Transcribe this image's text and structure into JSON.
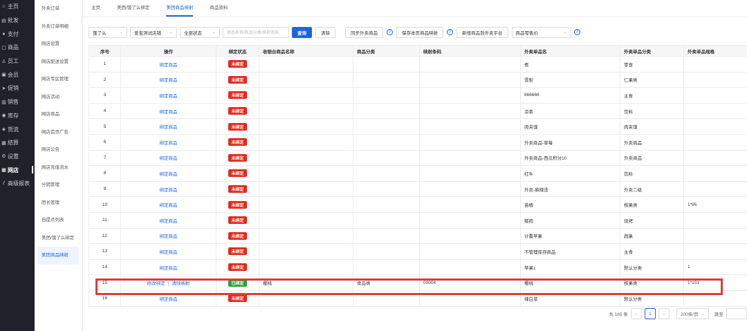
{
  "sidebar": {
    "items": [
      {
        "label": "主页",
        "icon": "home-icon",
        "glyph": "⌂",
        "active": false
      },
      {
        "label": "批发",
        "icon": "list-icon",
        "glyph": "▤",
        "active": false
      },
      {
        "label": "支付",
        "icon": "pay-icon",
        "glyph": "●",
        "active": false
      },
      {
        "label": "商品",
        "icon": "goods-icon",
        "glyph": "▢",
        "active": false
      },
      {
        "label": "员工",
        "icon": "staff-icon",
        "glyph": "♙",
        "active": false
      },
      {
        "label": "会员",
        "icon": "member-icon",
        "glyph": "▣",
        "active": false
      },
      {
        "label": "促销",
        "icon": "promo-icon",
        "glyph": "➤",
        "active": false
      },
      {
        "label": "销售",
        "icon": "sales-icon",
        "glyph": "▥",
        "active": false
      },
      {
        "label": "库存",
        "icon": "stock-icon",
        "glyph": "◉",
        "active": false
      },
      {
        "label": "货流",
        "icon": "logistics-icon",
        "glyph": "◈",
        "active": false
      },
      {
        "label": "结算",
        "icon": "settle-icon",
        "glyph": "▦",
        "active": false
      },
      {
        "label": "设置",
        "icon": "settings-icon",
        "glyph": "⚙",
        "active": false
      },
      {
        "label": "网店",
        "icon": "shop-icon",
        "glyph": "▩",
        "active": true
      },
      {
        "label": "高级报表",
        "icon": "report-icon",
        "glyph": "⫽",
        "active": false
      }
    ]
  },
  "submenu": {
    "items": [
      {
        "label": "外卖订单",
        "active": false
      },
      {
        "label": "外卖订单明细",
        "active": false
      },
      {
        "label": "网店设置",
        "active": false
      },
      {
        "label": "网店配送设置",
        "active": false
      },
      {
        "label": "网店专区管理",
        "active": false
      },
      {
        "label": "网店活动",
        "active": false
      },
      {
        "label": "网店商品",
        "active": false
      },
      {
        "label": "网店首页广告",
        "active": false
      },
      {
        "label": "网店公告",
        "active": false
      },
      {
        "label": "网店充值流水",
        "active": false
      },
      {
        "label": "分销管理",
        "active": false
      },
      {
        "label": "团长管理",
        "active": false
      },
      {
        "label": "自提点列表",
        "active": false
      },
      {
        "label": "美团/饿了么绑定",
        "active": false
      },
      {
        "label": "美团商品映射",
        "active": true
      }
    ]
  },
  "tabs": [
    {
      "label": "主页",
      "active": false
    },
    {
      "label": "美团/饿了么绑定",
      "active": false
    },
    {
      "label": "美团商品映射",
      "active": true
    },
    {
      "label": "商品资料",
      "active": false
    }
  ],
  "toolbar": {
    "platform_select": "饿了么",
    "store_select": "爱宝测试店铺",
    "status_select": "全部状态",
    "search_placeholder": "商品名称/商品分类/映射条码",
    "query_label": "查询",
    "clear_label": "清除",
    "sync_label": "同步外卖商品",
    "save_label": "保存本页商品映射",
    "add_label": "新增商品到外卖平台",
    "price_select": "商品零售价",
    "help_glyph": "?"
  },
  "table": {
    "columns": [
      "序号",
      "操作",
      "绑定状态",
      "收银台商品名称",
      "商品分类",
      "映射条码",
      "外卖单品名",
      "外卖单品分类",
      "外卖单品规格"
    ],
    "bind_action": "绑定商品",
    "unbound": "未绑定",
    "bound": "已绑定",
    "edit_action": "修改绑定",
    "clear_action": "清除映射",
    "action_sep": "|",
    "rows": [
      {
        "no": "1",
        "status": "未绑定",
        "pos_name": "",
        "category": "",
        "barcode": "",
        "item_name": "煮",
        "item_cat": "零食",
        "spec": ""
      },
      {
        "no": "2",
        "status": "未绑定",
        "pos_name": "",
        "category": "",
        "barcode": "",
        "item_name": "雪梨",
        "item_cat": "仁果类",
        "spec": ""
      },
      {
        "no": "3",
        "status": "未绑定",
        "pos_name": "",
        "category": "",
        "barcode": "",
        "item_name": "666666",
        "item_cat": "主食",
        "spec": ""
      },
      {
        "no": "4",
        "status": "未绑定",
        "pos_name": "",
        "category": "",
        "barcode": "",
        "item_name": "凉茶",
        "item_cat": "饮料",
        "spec": ""
      },
      {
        "no": "5",
        "status": "未绑定",
        "pos_name": "",
        "category": "",
        "barcode": "",
        "item_name": "肉夹馍",
        "item_cat": "肉夹馍",
        "spec": ""
      },
      {
        "no": "6",
        "status": "未绑定",
        "pos_name": "",
        "category": "",
        "barcode": "",
        "item_name": "外卖商品-草莓",
        "item_cat": "外卖商品",
        "spec": ""
      },
      {
        "no": "7",
        "status": "未绑定",
        "pos_name": "",
        "category": "",
        "barcode": "",
        "item_name": "外卖商品-西瓜积分10",
        "item_cat": "外卖商品",
        "spec": ""
      },
      {
        "no": "8",
        "status": "未绑定",
        "pos_name": "",
        "category": "",
        "barcode": "",
        "item_name": "红牛",
        "item_cat": "饮料",
        "spec": ""
      },
      {
        "no": "9",
        "status": "未绑定",
        "pos_name": "",
        "category": "",
        "barcode": "",
        "item_name": "外卖-麻辣烫",
        "item_cat": "外卖二级",
        "spec": ""
      },
      {
        "no": "10",
        "status": "未绑定",
        "pos_name": "",
        "category": "",
        "barcode": "",
        "item_name": "苗楂",
        "item_cat": "核果类",
        "spec": "1*95"
      },
      {
        "no": "11",
        "status": "未绑定",
        "pos_name": "",
        "category": "",
        "barcode": "",
        "item_name": "猪肉",
        "item_cat": "烧烤",
        "spec": ""
      },
      {
        "no": "12",
        "status": "未绑定",
        "pos_name": "",
        "category": "",
        "barcode": "",
        "item_name": "计重苹果",
        "item_cat": "蔬果",
        "spec": ""
      },
      {
        "no": "13",
        "status": "未绑定",
        "pos_name": "",
        "category": "",
        "barcode": "",
        "item_name": "不管理库存商品",
        "item_cat": "主食",
        "spec": ""
      },
      {
        "no": "14",
        "status": "未绑定",
        "pos_name": "",
        "category": "",
        "barcode": "",
        "item_name": "苹果1",
        "item_cat": "默认分类",
        "spec": "1"
      },
      {
        "no": "15",
        "status": "已绑定",
        "pos_name": "樱桃",
        "category": "食品类",
        "barcode": "00004",
        "item_name": "樱桃",
        "item_cat": "核果类",
        "spec": "1*101"
      },
      {
        "no": "16",
        "status": "未绑定",
        "pos_name": "",
        "category": "",
        "barcode": "",
        "item_name": "辣白菜",
        "item_cat": "默认分类",
        "spec": ""
      }
    ]
  },
  "pager": {
    "total": "共 165 条",
    "prev": "‹",
    "current": "1",
    "next": "›",
    "size": "200条/页",
    "size_chev": "⌄",
    "jump_label": "跳至"
  }
}
